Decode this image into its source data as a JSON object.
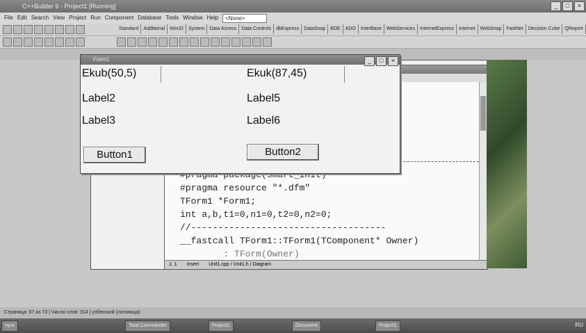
{
  "ide": {
    "title": "C++Builder 6 - Project1 [Running]",
    "menu": [
      "File",
      "Edit",
      "Search",
      "View",
      "Project",
      "Run",
      "Component",
      "Database",
      "Tools",
      "Window",
      "Help"
    ],
    "desktop_combo": "<None>",
    "palette_tabs": [
      "Standard",
      "Additional",
      "Win32",
      "System",
      "Data Access",
      "Data Controls",
      "dbExpress",
      "DataSnap",
      "BDE",
      "ADO",
      "InterBase",
      "WebServices",
      "InternetExpress",
      "Internet",
      "WebSnap",
      "FastNet",
      "Decision Cube",
      "QReport"
    ]
  },
  "form": {
    "title": "Form1",
    "labels": {
      "label1": "Ekub(50,5)",
      "label4": "Ekuk(87,45)",
      "label2": "Label2",
      "label5": "Label5",
      "label3": "Label3",
      "label6": "Label6"
    },
    "buttons": {
      "button1": "Button1",
      "button2": "Button2"
    }
  },
  "code": {
    "lines": [
      "#pragma package(smart_init)",
      "#pragma resource \"*.dfm\"",
      "TForm1 *Form1;",
      "int a,b,t1=0,n1=0,t2=0,n2=0;",
      "//------------------------------------",
      "__fastcall TForm1::TForm1(TComponent* Owner)",
      "        : TForm(Owner)"
    ],
    "status": {
      "position": "1: 1",
      "mode": "Insert",
      "tabs": "Unit1.cpp / Unit1.h / Diagram"
    }
  },
  "statusbar": {
    "text": "Страница: 67 из 73 | Число слов: 314 | узбекский (латиница)"
  },
  "taskbar": {
    "start": "пуск",
    "tasks": [
      "Total Commander",
      "Project1",
      "Document",
      "Project1"
    ],
    "clock": "RU"
  }
}
